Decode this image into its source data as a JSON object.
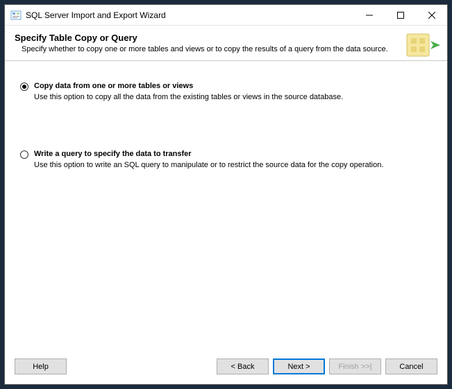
{
  "window": {
    "title": "SQL Server Import and Export Wizard"
  },
  "header": {
    "title": "Specify Table Copy or Query",
    "description": "Specify whether to copy one or more tables and views or to copy the results of a query from the data source."
  },
  "options": {
    "copy": {
      "title": "Copy data from one or more tables or views",
      "description": "Use this option to copy all the data from the existing tables or views in the source database.",
      "selected": true
    },
    "query": {
      "title": "Write a query to specify the data to transfer",
      "description": "Use this option to write an SQL query to manipulate or to restrict the source data for the copy operation.",
      "selected": false
    }
  },
  "buttons": {
    "help": "Help",
    "back": "< Back",
    "next": "Next >",
    "finish": "Finish >>|",
    "cancel": "Cancel"
  }
}
